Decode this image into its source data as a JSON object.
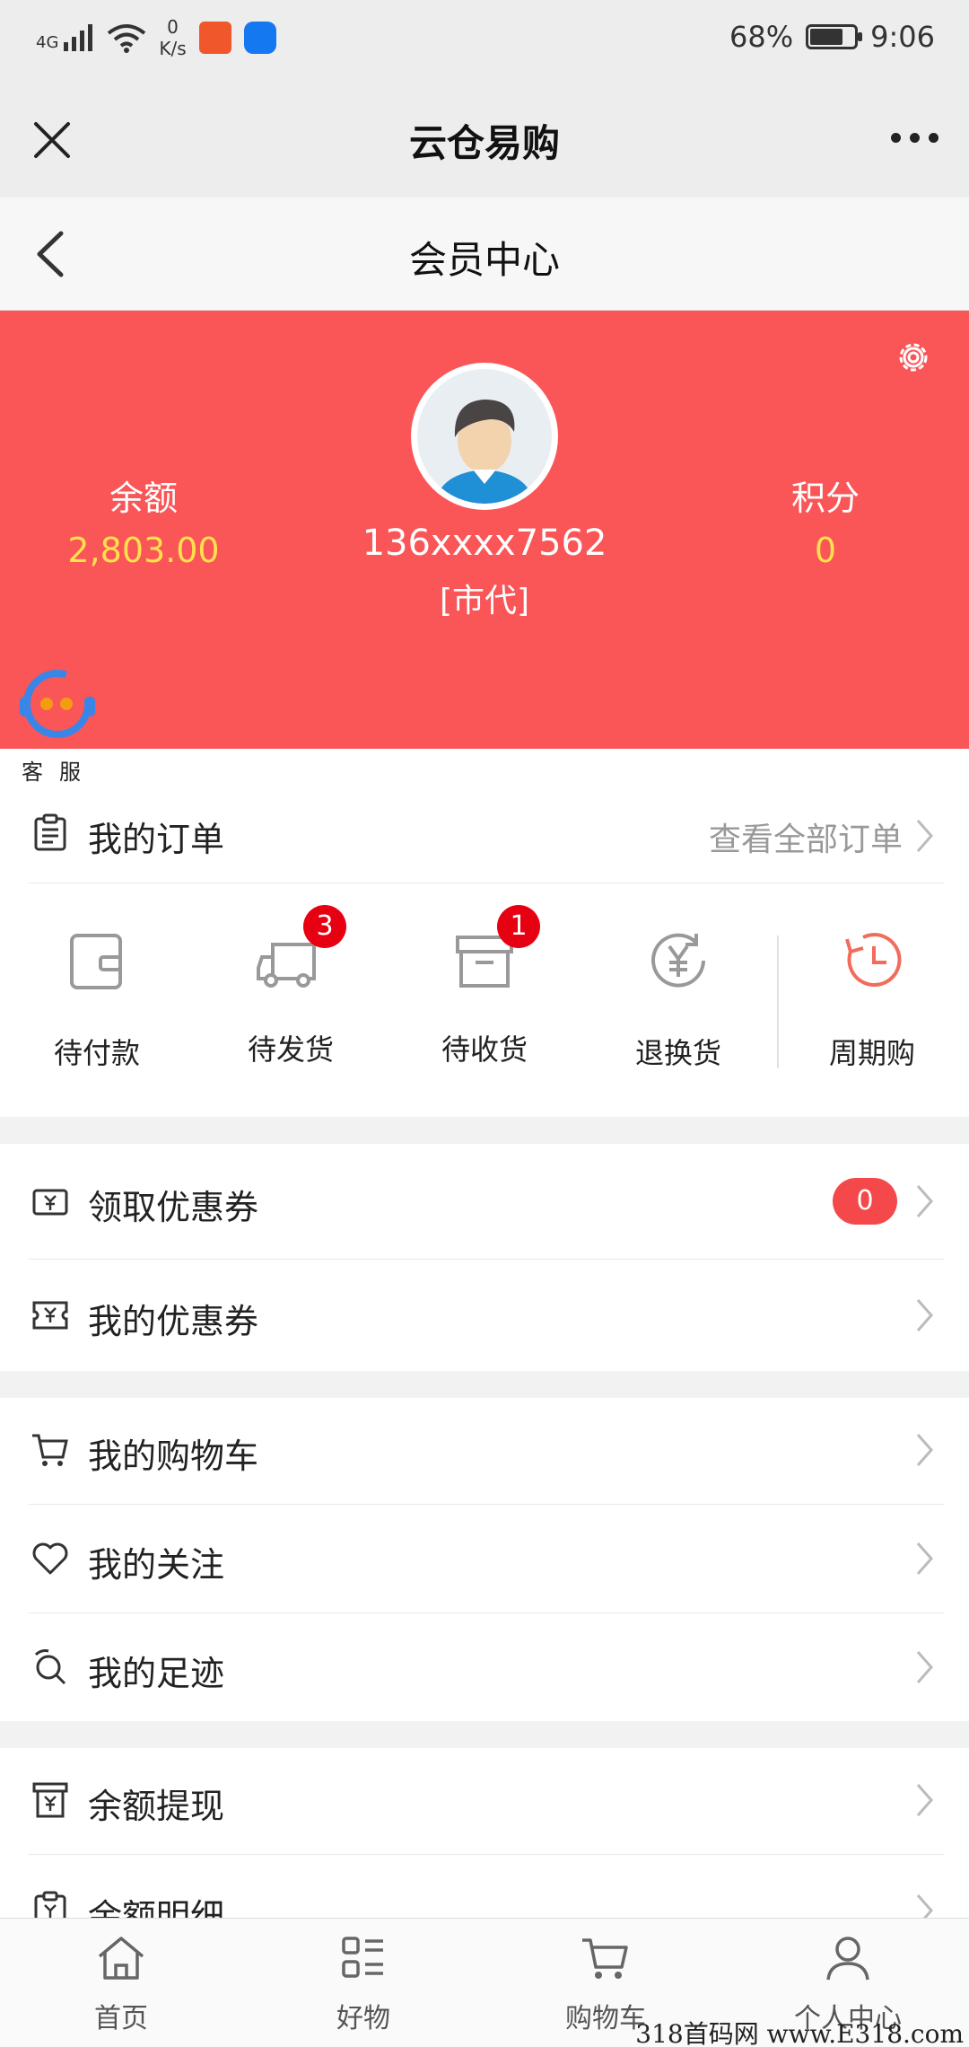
{
  "status_bar": {
    "network": "4G",
    "speed_value": "0",
    "speed_unit": "K/s",
    "battery": "68%",
    "time": "9:06"
  },
  "app_bar": {
    "title": "云仓易购"
  },
  "page_header": {
    "title": "会员中心"
  },
  "profile": {
    "balance_label": "余额",
    "balance_value": "2,803.00",
    "phone": "136xxxx7562",
    "role": "[市代]",
    "points_label": "积分",
    "points_value": "0"
  },
  "customer_service": {
    "label": "客服"
  },
  "orders": {
    "title": "我的订单",
    "view_all": "查看全部订单",
    "items": [
      {
        "label": "待付款",
        "badge": ""
      },
      {
        "label": "待发货",
        "badge": "3"
      },
      {
        "label": "待收货",
        "badge": "1"
      },
      {
        "label": "退换货",
        "badge": ""
      },
      {
        "label": "周期购",
        "badge": ""
      }
    ]
  },
  "coupons": {
    "get_coupon": "领取优惠券",
    "get_coupon_count": "0",
    "my_coupons": "我的优惠券"
  },
  "lists": {
    "cart": "我的购物车",
    "follow": "我的关注",
    "footprint": "我的足迹",
    "withdraw": "余额提现",
    "balance_detail": "余额明细"
  },
  "tabbar": {
    "items": [
      {
        "label": "首页"
      },
      {
        "label": "好物"
      },
      {
        "label": "购物车"
      },
      {
        "label": "个人中心"
      }
    ]
  },
  "watermark": "318首码网 www.E318.com",
  "colors": {
    "hero_bg": "#fa5557",
    "value_yellow": "#ffe14d",
    "badge_red": "#e60012",
    "cycle_icon": "#f26b5b"
  }
}
